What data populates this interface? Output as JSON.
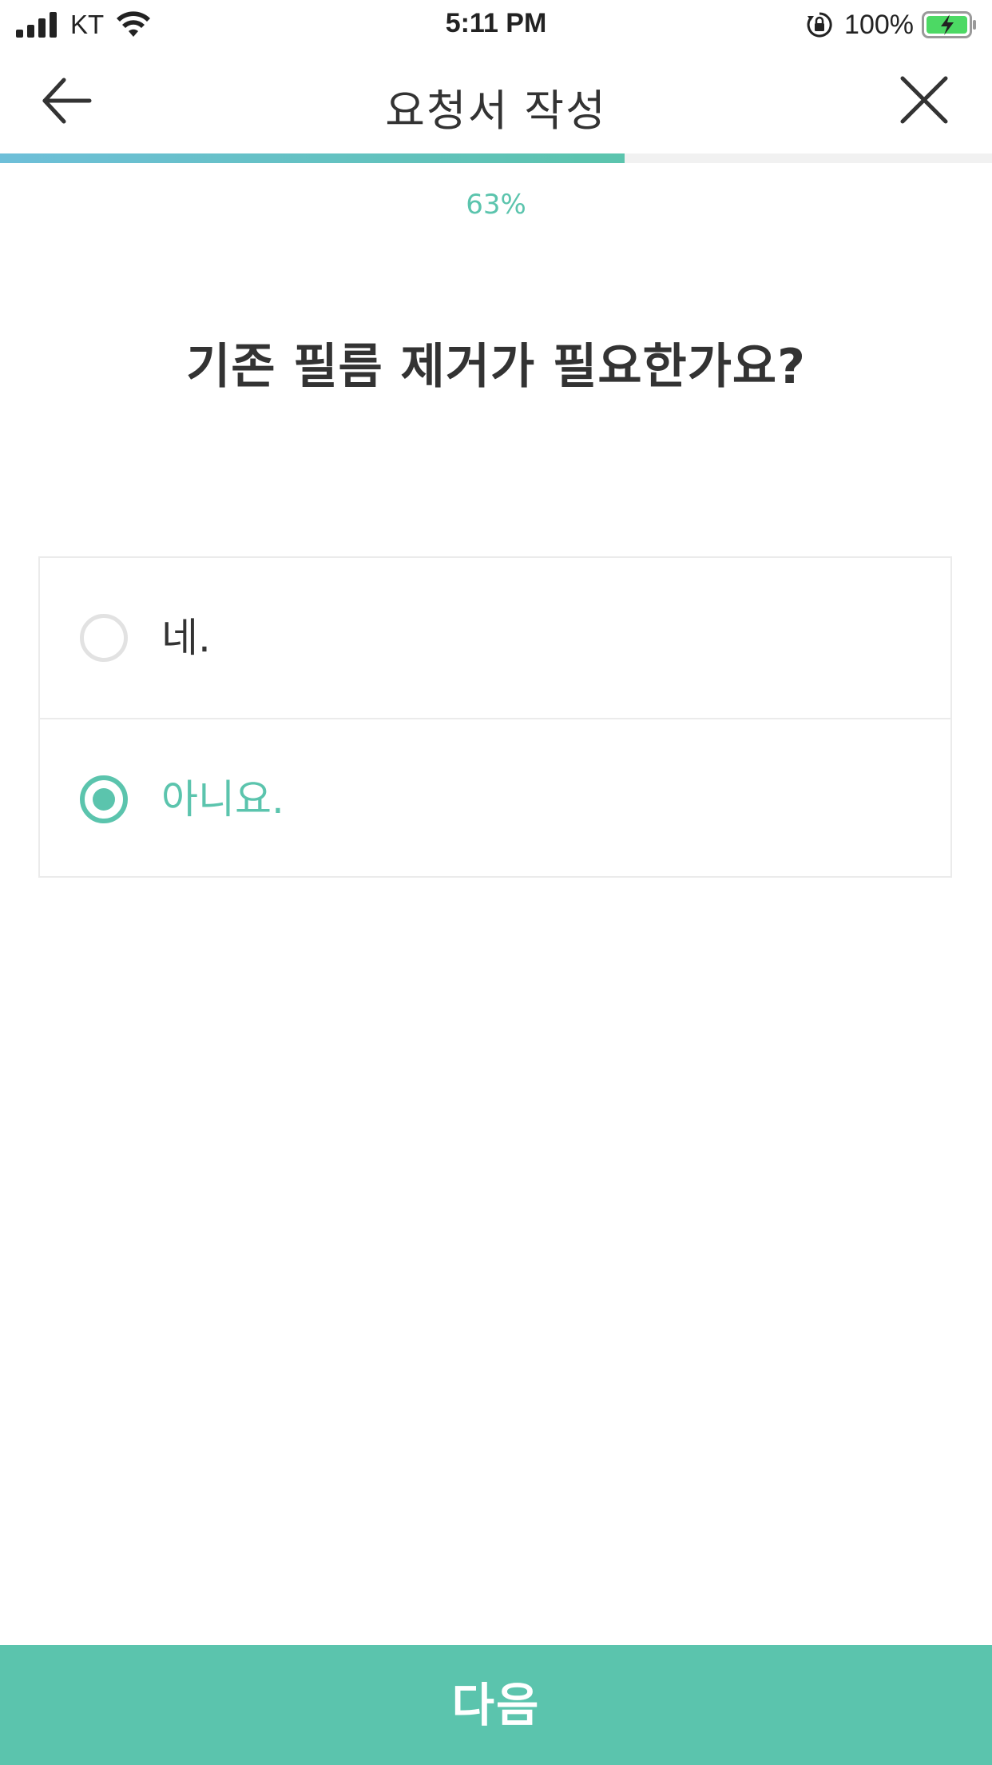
{
  "status_bar": {
    "carrier": "KT",
    "time": "5:11 PM",
    "battery_percent": "100%",
    "icons": [
      "signal-icon",
      "wifi-icon",
      "lock-rotation-icon",
      "battery-charging-icon"
    ]
  },
  "header": {
    "title": "요청서 작성",
    "back_icon": "arrow-left-icon",
    "close_icon": "close-icon"
  },
  "progress": {
    "percent_text": "63%",
    "value_fraction": 0.63
  },
  "question": {
    "title": "기존 필름 제거가 필요한가요?",
    "options": [
      {
        "label": "네.",
        "selected": false
      },
      {
        "label": "아니요.",
        "selected": true
      }
    ]
  },
  "footer": {
    "next_label": "다음"
  },
  "colors": {
    "accent": "#5bc4ad",
    "progress_start": "#6ebfd9",
    "text": "#333333",
    "border": "#ebebeb"
  }
}
